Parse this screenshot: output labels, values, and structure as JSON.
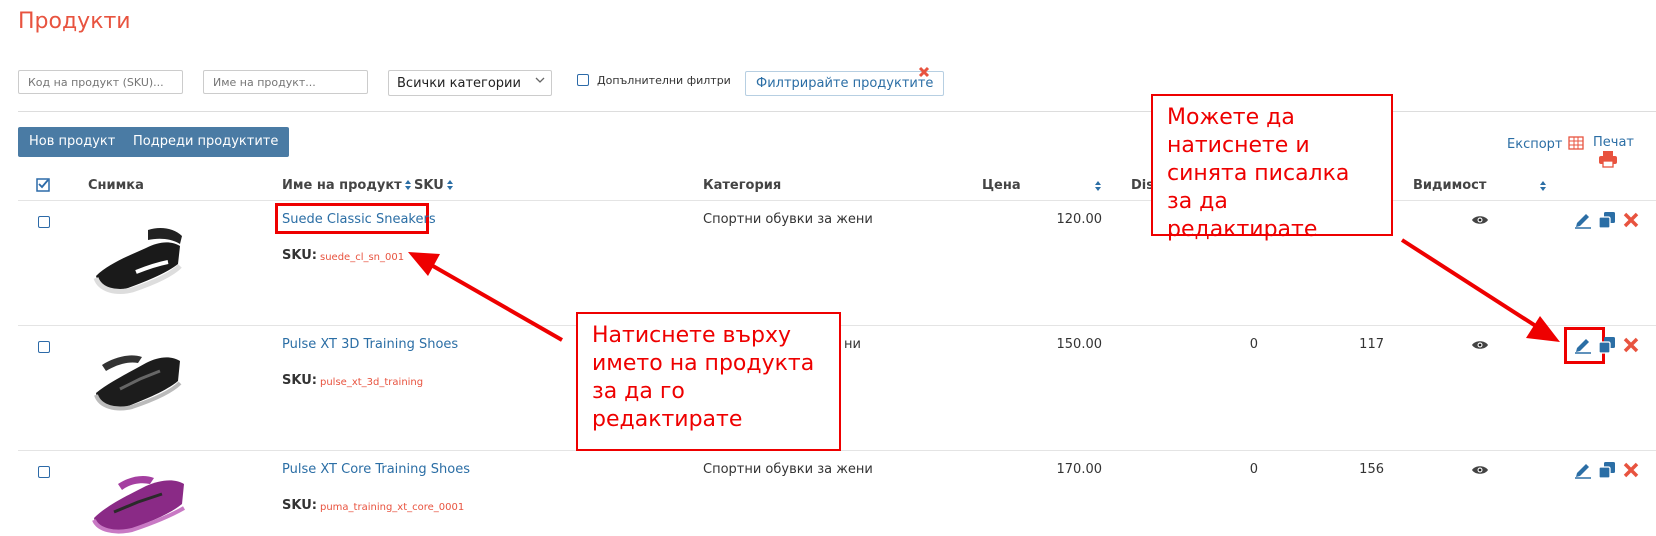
{
  "page": {
    "title": "Продукти"
  },
  "filters": {
    "sku_placeholder": "Код на продукт (SKU)...",
    "name_placeholder": "Име на продукт...",
    "category_selected": "Всички категории",
    "advanced_label": "Допълнителни филтри",
    "filter_button": "Филтрирайте продуктите"
  },
  "toolbar": {
    "new_product": "Нов продукт",
    "sort_products": "Подреди продуктите",
    "export": "Експорт",
    "print": "Печат"
  },
  "table": {
    "headers": {
      "image": "Снимка",
      "name": "Име на продукт",
      "sku": "SKU",
      "category": "Категория",
      "price": "Цена",
      "discount": "Dis",
      "visibility": "Видимост"
    },
    "sku_label": "SKU:",
    "rows": [
      {
        "name": "Suede Classic Sneakers",
        "sku": "suede_cl_sn_001",
        "category": "Спортни обувки за жени",
        "price": "120.00",
        "discount": "",
        "qty": ""
      },
      {
        "name": "Pulse XT 3D Training Shoes",
        "sku": "pulse_xt_3d_training",
        "category": "ни",
        "price": "150.00",
        "discount": "0",
        "qty": "117"
      },
      {
        "name": "Pulse XT Core Training Shoes",
        "sku": "puma_training_xt_core_0001",
        "category": "Спортни обувки за жени",
        "price": "170.00",
        "discount": "0",
        "qty": "156"
      }
    ]
  },
  "annotations": {
    "edit_pencil_note": "Можете да натиснете и синята писалка за да редактирате",
    "edit_name_note": "Натиснете върху името на продукта за да го редактирате"
  },
  "colors": {
    "accent_red": "#e8533f",
    "link_blue": "#2b6ea5",
    "button_blue": "#4a7ba4",
    "annotation_red": "#e00000"
  },
  "icons": [
    "chevron-down-icon",
    "close-icon",
    "spreadsheet-icon",
    "printer-icon",
    "sort-icon",
    "eye-icon",
    "pencil-icon",
    "copy-icon",
    "delete-icon",
    "checkbox-icon"
  ]
}
